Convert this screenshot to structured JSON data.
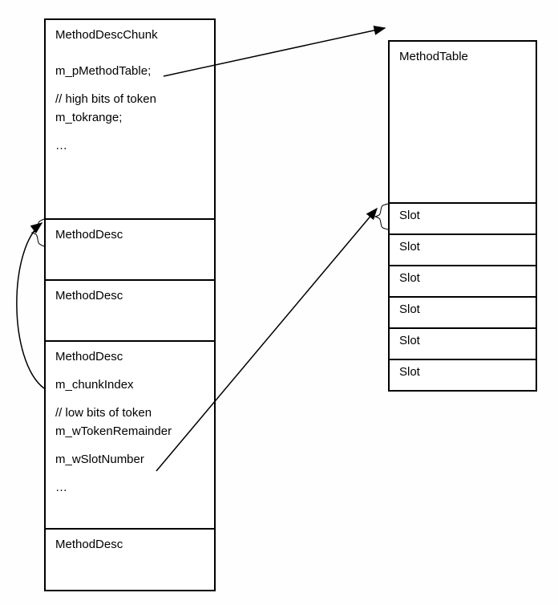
{
  "chunk": {
    "title": "MethodDescChunk",
    "field1": "m_pMethodTable;",
    "comment1": "// high bits of token",
    "field2": "m_tokrange;",
    "ellipsis": "…"
  },
  "methodDesc": {
    "label": "MethodDesc",
    "field1": "m_chunkIndex",
    "comment1": "// low bits of token",
    "field2": "m_wTokenRemainder",
    "field3": "m_wSlotNumber",
    "ellipsis": "…"
  },
  "methodTable": {
    "title": "MethodTable",
    "slotLabel": "Slot"
  }
}
